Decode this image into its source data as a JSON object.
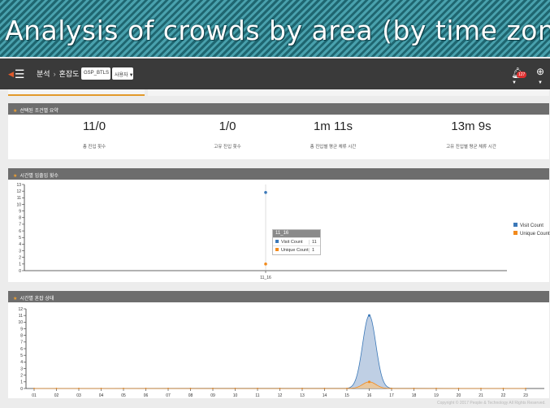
{
  "page": {
    "title": "Analysis of crowds by area (by time zone)"
  },
  "navbar": {
    "menu_icon": "menu-icon",
    "breadcrumb": [
      "분석",
      "혼잡도"
    ],
    "selects": [
      "GSP_BTLS",
      "사용자"
    ],
    "notification_count": "127",
    "bell_icon": "bell-icon",
    "globe_icon": "globe-icon"
  },
  "summary": {
    "title": "선택된 조건별 요약",
    "metrics": [
      {
        "value": "11/0",
        "label": "총 진입 횟수"
      },
      {
        "value": "1/0",
        "label": "고유 진입 횟수"
      },
      {
        "value": "1m 11s",
        "label": "총 진입별 평균 체류 시간"
      },
      {
        "value": "13m 9s",
        "label": "고유 진입별 평균 체류 시간"
      }
    ]
  },
  "visits_chart": {
    "panel_title": "시간별 입출입 횟수",
    "tooltip": {
      "header": "11_16",
      "rows": [
        {
          "label": "Visit Count",
          "value": "11"
        },
        {
          "label": "Unique Count",
          "value": "1"
        }
      ]
    }
  },
  "crowd_chart": {
    "panel_title": "시간별 혼잡 상태"
  },
  "chart_data": [
    {
      "type": "scatter",
      "x": [
        "11_16"
      ],
      "series": [
        {
          "name": "Visit Count",
          "values": [
            11.8
          ],
          "color": "#3b78b8"
        },
        {
          "name": "Unique Count",
          "values": [
            1
          ],
          "color": "#f28a1c"
        }
      ],
      "ylim": [
        0,
        13
      ],
      "yticks": [
        "0",
        "1",
        "2",
        "3",
        "4",
        "5",
        "6",
        "7",
        "8",
        "9",
        "10",
        "11",
        "12",
        "13"
      ],
      "xticks": [
        "11_16"
      ],
      "legend": "right",
      "grid": false
    },
    {
      "type": "area",
      "x": [
        "01",
        "02",
        "03",
        "04",
        "05",
        "06",
        "07",
        "08",
        "09",
        "10",
        "11",
        "12",
        "13",
        "14",
        "15",
        "16",
        "17",
        "18",
        "19",
        "20",
        "21",
        "22",
        "23"
      ],
      "series": [
        {
          "values": [
            0,
            0,
            0,
            0,
            0,
            0,
            0,
            0,
            0,
            0,
            0,
            0,
            0,
            0,
            0,
            11,
            0,
            0,
            0,
            0,
            0,
            0,
            0
          ],
          "color": "#a9bfdb",
          "line": "#3b78b8"
        },
        {
          "values": [
            0,
            0,
            0,
            0,
            0,
            0,
            0,
            0,
            0,
            0,
            0,
            0,
            0,
            0,
            0,
            1,
            0,
            0,
            0,
            0,
            0,
            0,
            0
          ],
          "color": "#f5c58a",
          "line": "#f28a1c"
        }
      ],
      "ylim": [
        0,
        12
      ],
      "yticks": [
        "0",
        "1",
        "2",
        "3",
        "4",
        "5",
        "6",
        "7",
        "8",
        "9",
        "10",
        "11",
        "12"
      ],
      "legend": "none",
      "grid": false
    }
  ],
  "footer": {
    "copyright": "Copyright © 2017 People & Technology All Rights Reserved."
  }
}
